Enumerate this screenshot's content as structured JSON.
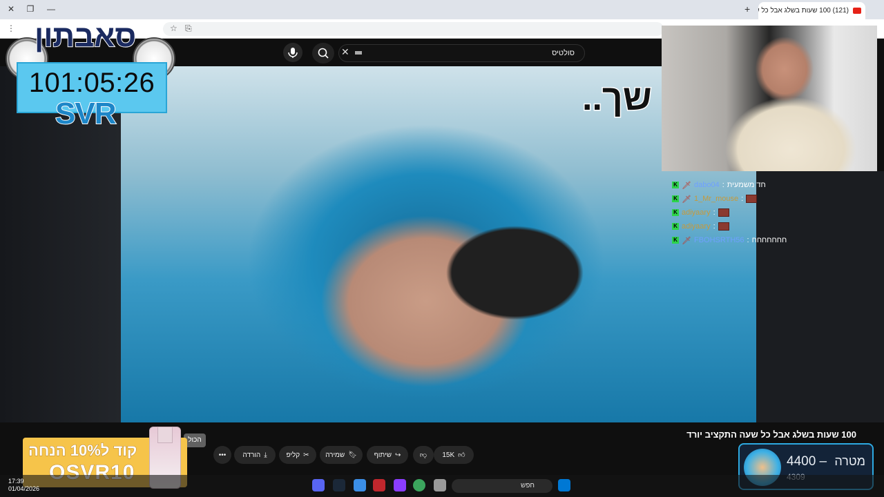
{
  "browser": {
    "tab_title": "(121) 100 שעות בשלג אבל כל ש",
    "new_tab_label": "+",
    "close_tab_label": "✕"
  },
  "search": {
    "query": "סולטיס"
  },
  "video": {
    "caption": "שך..",
    "title": "100 שעות בשלג אבל כל שעה התקציב יורד"
  },
  "overlay": {
    "logo_text": "סאבתון",
    "timer": "101:05:26",
    "tag": "SVR"
  },
  "chat": [
    {
      "user": "dabo04",
      "message": "חד משמעית",
      "user_style": "blue"
    },
    {
      "user": "1_Mr_mouse",
      "message": "",
      "user_style": "normal"
    },
    {
      "user": "adiyaary",
      "message": "",
      "user_style": "normal"
    },
    {
      "user": "adiyaary",
      "message": "",
      "user_style": "normal"
    },
    {
      "user": "FBOHSRTH56",
      "message": "חחחחחחח",
      "user_style": "blue"
    }
  ],
  "actions": {
    "like_count": "15K",
    "share": "שיתוף",
    "save": "שמירה",
    "clip": "קליפ",
    "download": "הורדה",
    "more": "•••",
    "tooltip": "הכול"
  },
  "promo": {
    "line1": "קוד ל10% הנחה",
    "line2": "OSVR10"
  },
  "goal": {
    "label": "מטרה",
    "target": "4400",
    "current": "4309"
  },
  "taskbar": {
    "search_placeholder": "חפש",
    "time": "17:39",
    "date": "01/04/2026"
  },
  "colors": {
    "accent": "#2da9e1",
    "timer_bg": "#5bc8ef",
    "promo_bg": "#f6c44a",
    "youtube_red": "#e62117"
  }
}
